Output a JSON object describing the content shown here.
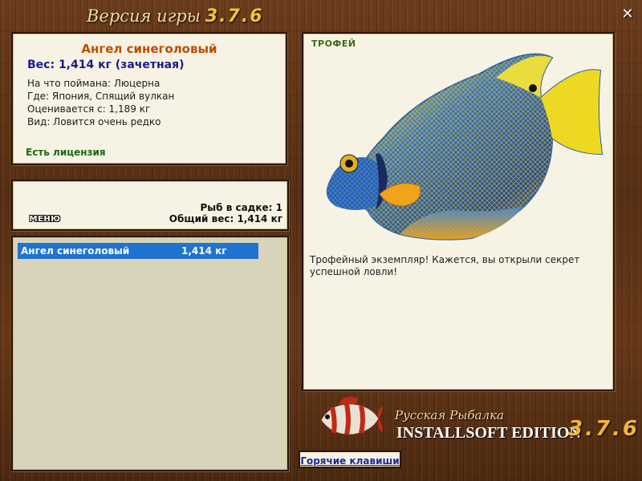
{
  "window": {
    "title_prefix": "Версия игры",
    "version": "3.7.6",
    "close_glyph": "✕"
  },
  "fish_info": {
    "name": "Ангел синеголовый",
    "weight": "Вес: 1,414 кг (зачетная)",
    "caught_on": "На что поймана: Люцерна",
    "where": "Где: Япония, Спящий вулкан",
    "valued_from": "Оценивается с: 1,189 кг",
    "rarity": "Вид: Ловится очень редко",
    "license": "Есть лицензия"
  },
  "keepnet": {
    "menu_label": "МЕНЮ",
    "count": "Рыб в садке: 1",
    "total_weight": "Общий вес: 1,414 кг"
  },
  "catch_list": [
    {
      "name": "Ангел синеголовый",
      "weight": "1,414 кг"
    }
  ],
  "photo": {
    "badge": "ТРОФЕЙ",
    "description": "Трофейный экземпляр! Кажется, вы открыли секрет успешной ловли!"
  },
  "logo": {
    "line1": "Русская Рыбалка",
    "line2": "INSTALLSOFT EDITION",
    "version": "3.7.6"
  },
  "hotkeys_label": "Горячие клавиши",
  "colors": {
    "wood": "#5a3014",
    "panel": "#f7f3e4",
    "accent_name": "#c04a00",
    "weight_blue": "#1a1b8c",
    "license_green": "#1b6a12",
    "selection_blue": "#1f73d1"
  }
}
